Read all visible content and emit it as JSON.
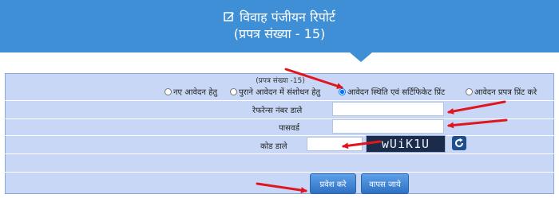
{
  "header": {
    "title": "विवाह पंजीयन रिपोर्ट",
    "subtitle": "(प्रपत्र संख्या - 15)",
    "icon": "edit-icon"
  },
  "form": {
    "legend": "(प्रपत्र संख्या -15)",
    "radio_options": [
      {
        "label": "नए आवेदन हेतु",
        "selected": false
      },
      {
        "label": "पुराने आवेदन में संशोधन हेतु",
        "selected": false
      },
      {
        "label": "आवेदन स्थिति एवं सर्टिफिकेट प्रिंट",
        "selected": true
      },
      {
        "label": "आवेदन प्रपत्र प्रिंट करे",
        "selected": false
      }
    ],
    "reference_label": "रेफरेन्स नंबर डाले",
    "reference_value": "",
    "password_label": "पासवर्ड",
    "password_value": "",
    "code_label": "कोड डाले",
    "code_value": "",
    "captcha_text": "wUiK1U",
    "submit_label": "प्रवेश करे",
    "back_label": "वापस जाये"
  },
  "colors": {
    "header_bg": "#3f8fd6",
    "form_bg": "#c7d7f5",
    "button_bg": "#2e71c4",
    "annotation_arrow": "#e0161e"
  }
}
